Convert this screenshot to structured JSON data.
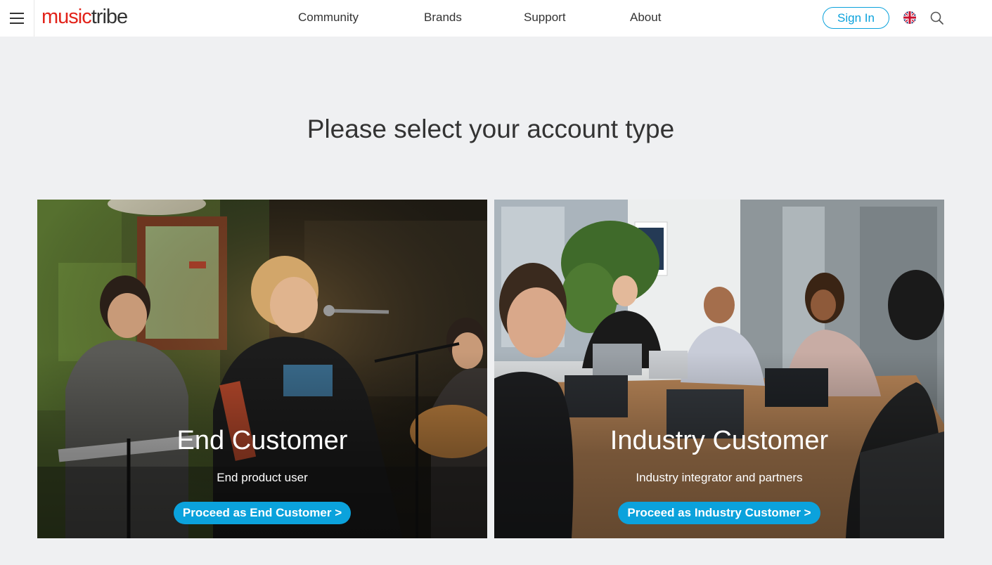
{
  "header": {
    "logo": {
      "part1": "music",
      "part2": "tribe"
    },
    "nav": [
      "Community",
      "Brands",
      "Support",
      "About"
    ],
    "sign_in": "Sign In"
  },
  "main": {
    "title": "Please select your account type",
    "cards": [
      {
        "title": "End Customer",
        "subtitle": "End product user",
        "button": "Proceed as End Customer >"
      },
      {
        "title": "Industry Customer",
        "subtitle": "Industry integrator and partners",
        "button": "Proceed as Industry Customer >"
      }
    ]
  },
  "colors": {
    "accent": "#0ba2dc",
    "brand_red": "#e2231a",
    "background": "#eff0f2"
  },
  "icons": [
    "hamburger-menu-icon",
    "uk-flag-icon",
    "search-icon"
  ]
}
